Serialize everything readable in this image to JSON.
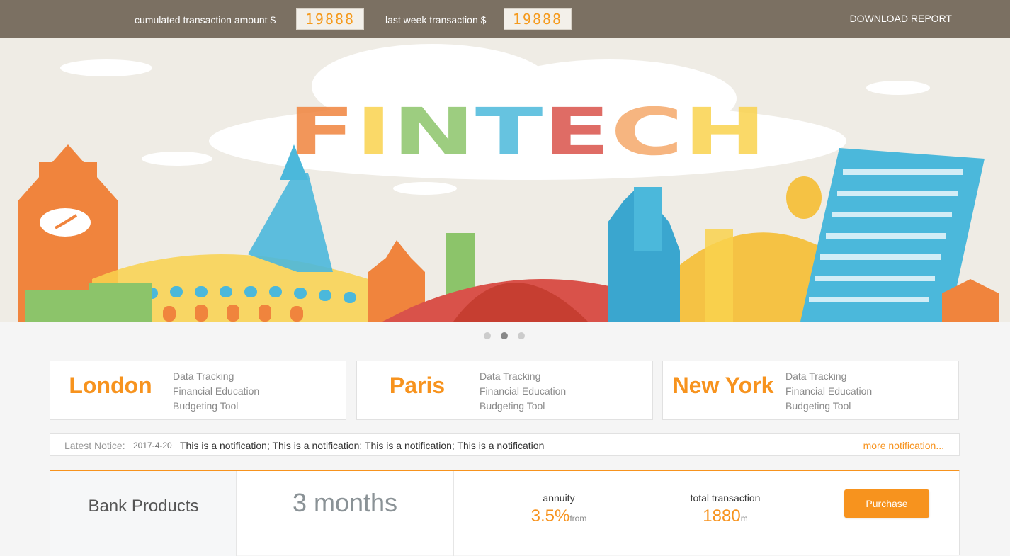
{
  "topbar": {
    "cumulated_label": "cumulated transaction amount $",
    "cumulated_value": "19888",
    "last_week_label": "last week transaction $",
    "last_week_value": "19888",
    "download_label": "DOWNLOAD REPORT"
  },
  "banner": {
    "title": "FINTECH",
    "title_colors": [
      "#f0843d",
      "#f9d24e",
      "#8cc46a",
      "#4bb8db",
      "#d9524a",
      "#f5a86a",
      "#f9d24e"
    ],
    "carousel_active": 2,
    "carousel_count": 3
  },
  "cities": [
    {
      "name": "London",
      "features": [
        "Data Tracking",
        "Financial Education",
        "Budgeting Tool"
      ]
    },
    {
      "name": "Paris",
      "features": [
        "Data Tracking",
        "Financial Education",
        "Budgeting Tool"
      ]
    },
    {
      "name": "New York",
      "features": [
        "Data Tracking",
        "Financial Education",
        "Budgeting Tool"
      ]
    }
  ],
  "notice": {
    "label": "Latest Notice:",
    "date": "2017-4-20",
    "text": "This is a notification; This is a notification; This is a notification; This is a notification",
    "more": "more notification..."
  },
  "product": {
    "name": "Bank Products",
    "term": "3 months",
    "annuity_label": "annuity",
    "annuity_value": "3.5%",
    "annuity_suffix": "from",
    "total_label": "total transaction",
    "total_value": "1880",
    "total_suffix": "m",
    "purchase_label": "Purchase"
  },
  "colors": {
    "accent": "#f7931e",
    "topbar": "#7b7062"
  }
}
